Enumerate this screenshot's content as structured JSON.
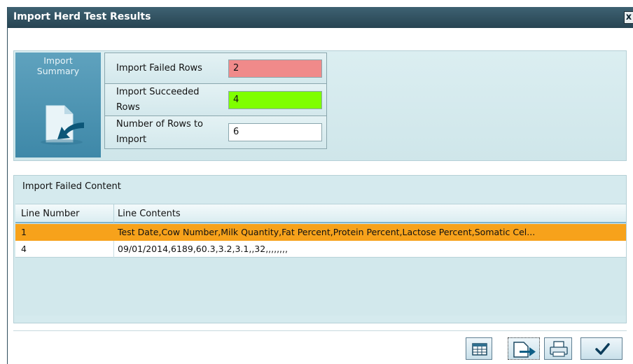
{
  "window": {
    "title": "Import Herd Test Results",
    "close_glyph": "x"
  },
  "summary": {
    "tile_label": "Import\nSummary",
    "icon": "import-arrow-icon",
    "rows": [
      {
        "label": "Import Failed Rows",
        "value": "2",
        "color": "#f08a8a"
      },
      {
        "label": "Import Succeeded\nRows",
        "value": "4",
        "color": "#7fff00"
      },
      {
        "label": "Number of Rows to\nImport",
        "value": "6",
        "color": "#ffffff"
      }
    ]
  },
  "failed": {
    "heading": "Import Failed Content",
    "columns": [
      "Line Number",
      "Line Contents"
    ],
    "rows": [
      {
        "line": "1",
        "contents": "Test Date,Cow Number,Milk Quantity,Fat Percent,Protein Percent,Lactose Percent,Somatic Cel...",
        "selected": true
      },
      {
        "line": "4",
        "contents": "09/01/2014,6189,60.3,3.2,3.1,,32,,,,,,,,",
        "selected": false
      }
    ]
  },
  "toolbar": {
    "buttons": [
      "grid-icon",
      "export-icon",
      "print-icon",
      "checkmark-icon"
    ]
  }
}
